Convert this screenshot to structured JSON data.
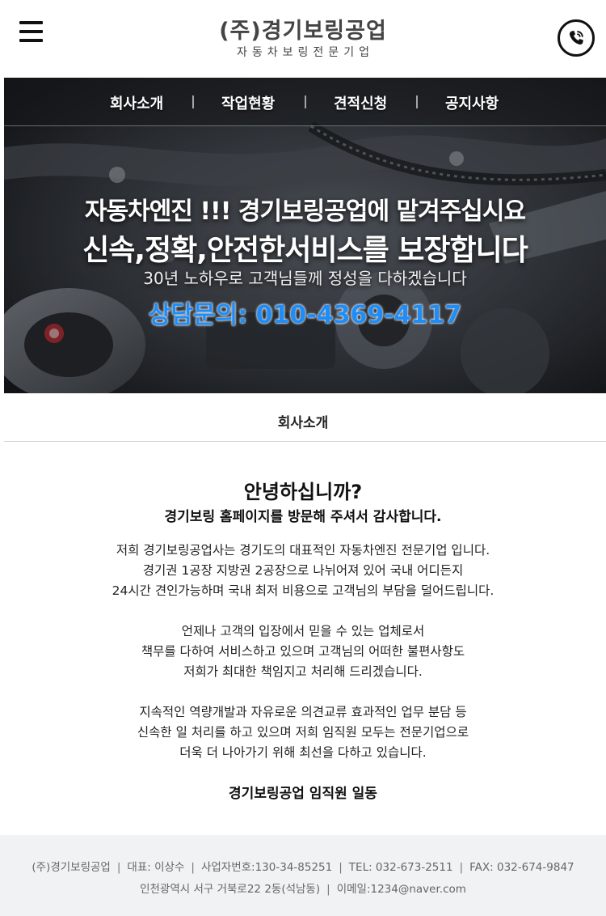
{
  "header": {
    "menu_icon": "hamburger-menu-icon",
    "logo_title": "(주)경기보링공업",
    "logo_subtitle": "자동차보링전문기업",
    "phone_icon": "phone-call-icon"
  },
  "nav": {
    "items": [
      "회사소개",
      "작업현황",
      "견적신청",
      "공지사항"
    ]
  },
  "hero": {
    "line1": "자동차엔진 !!! 경기보링공업에 맡겨주십시요",
    "line2": "신속,정확,안전한서비스를 보장합니다",
    "line3": "30년 노하우로 고객님들께 정성을 다하겠습니다",
    "contact": "상담문의: 010-4369-4117",
    "contact_color": "#1f8df7"
  },
  "section": {
    "title": "회사소개"
  },
  "content": {
    "greeting": "안녕하십니까?",
    "greeting_sub": "경기보링 홈페이지를 방문해 주셔서 감사합니다.",
    "paragraph1": [
      "저희 경기보링공업사는 경기도의 대표적인 자동차엔진 전문기업 입니다.",
      "경기권 1공장 지방권 2공장으로 나뉘어져 있어 국내 어디든지",
      "24시간 견인가능하며 국내 최저 비용으로 고객님의 부담을 덜어드립니다."
    ],
    "paragraph2": [
      "언제나 고객의 입장에서 믿을 수 있는 업체로서",
      "책무를 다하여 서비스하고 있으며 고객님의 어떠한 불편사항도",
      "저희가 최대한 책임지고 처리해 드리겠습니다."
    ],
    "paragraph3": [
      "지속적인 역량개발과 자유로운 의견교류 효과적인 업무 분담 등",
      "신속한 일 처리를 하고 있으며 저희 임직원 모두는 전문기업으로",
      "더욱 더 나아가기 위해 최선을 다하고 있습니다."
    ],
    "signature": "경기보링공업 임직원 일동"
  },
  "footer": {
    "company": "(주)경기보링공업",
    "ceo": "대표: 이상수",
    "biz_no": "사업자번호:130-34-85251",
    "tel": "TEL: 032-673-2511",
    "fax": "FAX: 032-674-9847",
    "address": "인천광역시 서구 거북로22 2동(석남동)",
    "email": "이메일:1234@naver.com",
    "separator": "|"
  }
}
